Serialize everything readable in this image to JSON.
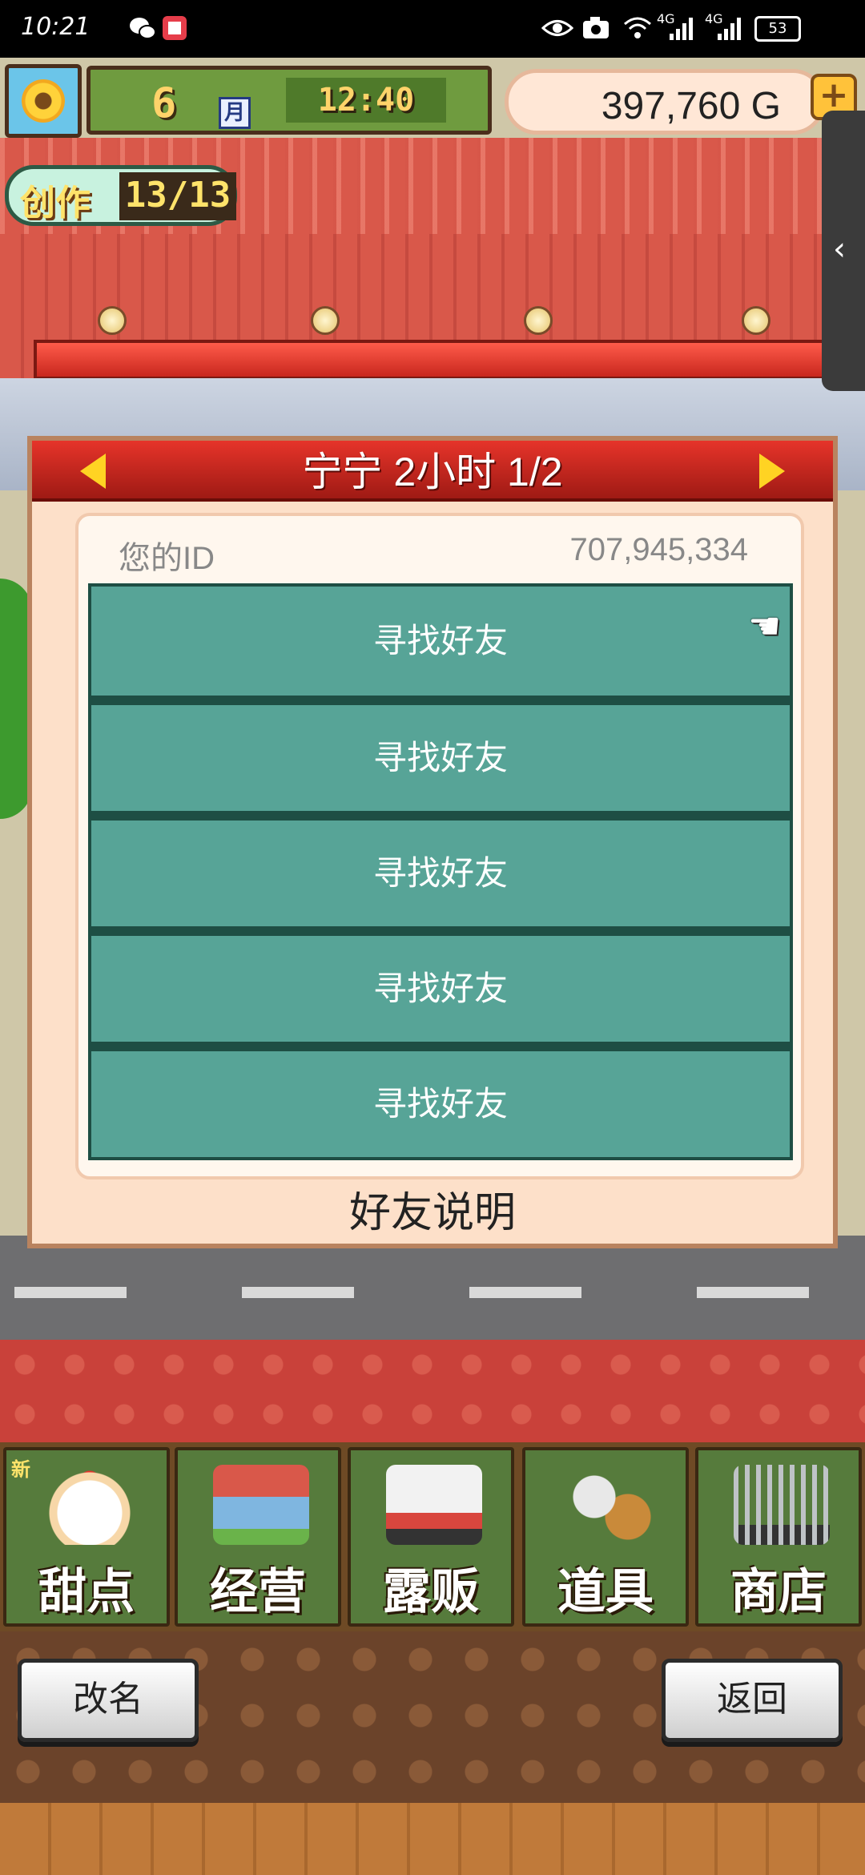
{
  "status_bar": {
    "time": "10:21",
    "network_1": "4G",
    "network_2": "4G",
    "battery": "53"
  },
  "hud": {
    "month": "6",
    "month_label": "月",
    "clock": "12:40",
    "money": "397,760 G",
    "add_icon": "plus-icon",
    "create_label": "创作",
    "create_count": "13/13"
  },
  "dialog": {
    "title": "宁宁  2小时 1/2",
    "id_label": "您的ID",
    "id_value": "707,945,334",
    "slots": [
      {
        "label": "寻找好友"
      },
      {
        "label": "寻找好友"
      },
      {
        "label": "寻找好友"
      },
      {
        "label": "寻找好友"
      },
      {
        "label": "寻找好友"
      }
    ],
    "footer": "好友说明"
  },
  "menu": {
    "new_badge": "新",
    "items": [
      {
        "label": "甜点",
        "icon": "cake-icon"
      },
      {
        "label": "经营",
        "icon": "store-icon"
      },
      {
        "label": "露贩",
        "icon": "food-truck-icon"
      },
      {
        "label": "道具",
        "icon": "items-icon"
      },
      {
        "label": "商店",
        "icon": "cart-icon"
      }
    ]
  },
  "buttons": {
    "rename": "改名",
    "back": "返回"
  },
  "colors": {
    "header_red": "#c8271e",
    "slot_teal": "#57a497",
    "panel_bg": "#fde0c9",
    "menu_green": "#567b3c"
  }
}
